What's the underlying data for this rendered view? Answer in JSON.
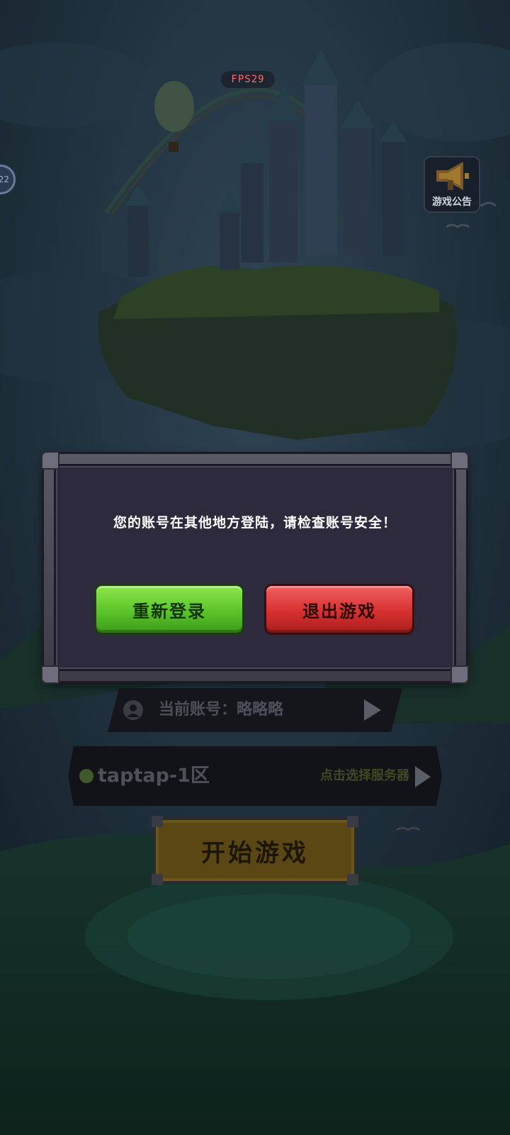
{
  "fps": "FPS29",
  "side_badge": "22",
  "announcement": {
    "label": "游戏公告",
    "icon": "megaphone-icon"
  },
  "dialog": {
    "message": "您的账号在其他地方登陆，请检查账号安全！",
    "relogin_label": "重新登录",
    "exit_label": "退出游戏"
  },
  "account": {
    "label": "当前账号：略略略",
    "icon": "user-icon"
  },
  "server": {
    "name": "taptap-1区",
    "select_label": "点击选择服务器",
    "status_color": "#3f5a2a"
  },
  "start_label": "开始游戏",
  "colors": {
    "relogin_green": "#5cc42a",
    "exit_red": "#d83030",
    "start_gold": "#5a4714"
  }
}
